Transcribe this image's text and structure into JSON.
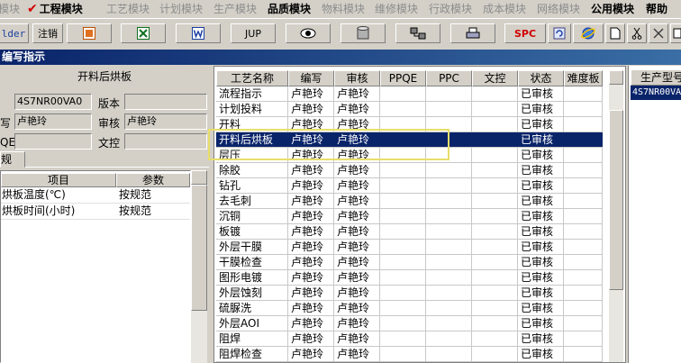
{
  "menu": {
    "items": [
      {
        "label": "模块",
        "state": "dim"
      },
      {
        "label": "工程模块",
        "state": "bold"
      },
      {
        "label": "工艺模块",
        "state": "dim"
      },
      {
        "label": "计划模块",
        "state": "dim"
      },
      {
        "label": "生产模块",
        "state": "dim"
      },
      {
        "label": "品质模块",
        "state": "bold"
      },
      {
        "label": "物料模块",
        "state": "dim"
      },
      {
        "label": "维修模块",
        "state": "dim"
      },
      {
        "label": "行政模块",
        "state": "dim"
      },
      {
        "label": "成本模块",
        "state": "dim"
      },
      {
        "label": "网络模块",
        "state": "dim"
      },
      {
        "label": "公用模块",
        "state": "bold"
      },
      {
        "label": "帮助",
        "state": "bold"
      }
    ]
  },
  "toolbar": {
    "folder_label": "lder",
    "logout_label": "注销",
    "jup_label": "JUP",
    "spc_label": "SPC"
  },
  "window": {
    "title": "编写指示"
  },
  "left": {
    "heading": "开料后烘板",
    "code_value": "4S7NR00VA0",
    "version_label": "版本",
    "writer_label": "写",
    "writer_value": "卢艳玲",
    "reviewer_label": "审核",
    "reviewer_value": "卢艳玲",
    "qe_label": "QE",
    "doc_label": "文控",
    "tab_label": "规",
    "grid_headers": [
      "项目",
      "参数"
    ],
    "grid_rows": [
      {
        "item": "烘板温度(℃)",
        "param": "按规范"
      },
      {
        "item": "烘板时间(小时)",
        "param": "按规范"
      }
    ]
  },
  "grid": {
    "headers": [
      "工艺名称",
      "编写",
      "审核",
      "PPQE",
      "PPC",
      "文控",
      "状态",
      "难度板"
    ],
    "rows": [
      {
        "name": "流程指示",
        "writer": "卢艳玲",
        "reviewer": "卢艳玲",
        "status": "已审核"
      },
      {
        "name": "计划投料",
        "writer": "卢艳玲",
        "reviewer": "卢艳玲",
        "status": "已审核"
      },
      {
        "name": "开料",
        "writer": "卢艳玲",
        "reviewer": "卢艳玲",
        "status": "已审核"
      },
      {
        "name": "开料后烘板",
        "writer": "卢艳玲",
        "reviewer": "卢艳玲",
        "status": "已审核",
        "selected": true
      },
      {
        "name": "层压",
        "writer": "卢艳玲",
        "reviewer": "卢艳玲",
        "status": "已审核"
      },
      {
        "name": "除胶",
        "writer": "卢艳玲",
        "reviewer": "卢艳玲",
        "status": "已审核"
      },
      {
        "name": "钻孔",
        "writer": "卢艳玲",
        "reviewer": "卢艳玲",
        "status": "已审核"
      },
      {
        "name": "去毛刺",
        "writer": "卢艳玲",
        "reviewer": "卢艳玲",
        "status": "已审核"
      },
      {
        "name": "沉铜",
        "writer": "卢艳玲",
        "reviewer": "卢艳玲",
        "status": "已审核"
      },
      {
        "name": "板镀",
        "writer": "卢艳玲",
        "reviewer": "卢艳玲",
        "status": "已审核"
      },
      {
        "name": "外层干膜",
        "writer": "卢艳玲",
        "reviewer": "卢艳玲",
        "status": "已审核"
      },
      {
        "name": "干膜检查",
        "writer": "卢艳玲",
        "reviewer": "卢艳玲",
        "status": "已审核"
      },
      {
        "name": "图形电镀",
        "writer": "卢艳玲",
        "reviewer": "卢艳玲",
        "status": "已审核"
      },
      {
        "name": "外层蚀刻",
        "writer": "卢艳玲",
        "reviewer": "卢艳玲",
        "status": "已审核"
      },
      {
        "name": "硫脲洗",
        "writer": "卢艳玲",
        "reviewer": "卢艳玲",
        "status": "已审核"
      },
      {
        "name": "外层AOI",
        "writer": "卢艳玲",
        "reviewer": "卢艳玲",
        "status": "已审核"
      },
      {
        "name": "阻焊",
        "writer": "卢艳玲",
        "reviewer": "卢艳玲",
        "status": "已审核"
      },
      {
        "name": "阻焊检查",
        "writer": "卢艳玲",
        "reviewer": "卢艳玲",
        "status": "已审核"
      }
    ]
  },
  "right": {
    "header": "生产型号",
    "value": "4S7NR00VA"
  },
  "colors": {
    "selection": "#0a246a",
    "title_bar": "#0a246a",
    "highlight": "#e8de6a"
  }
}
